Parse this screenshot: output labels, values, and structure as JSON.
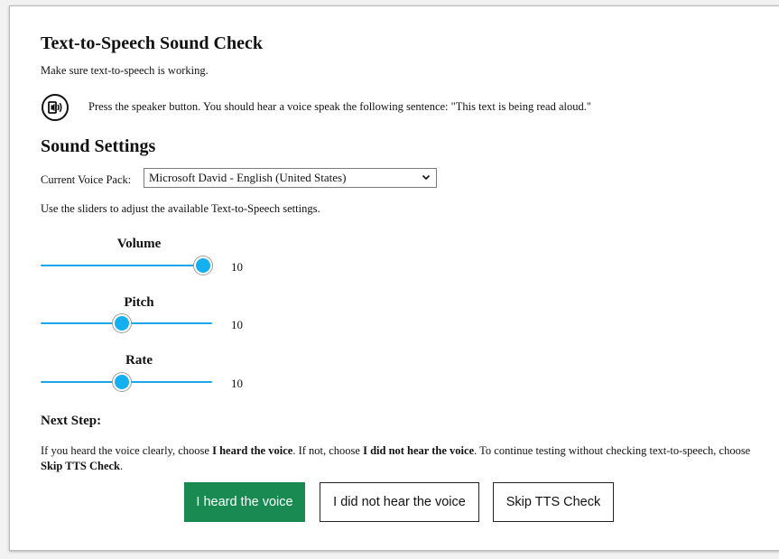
{
  "header": {
    "title": "Text-to-Speech Sound Check",
    "subtitle": "Make sure text-to-speech is working."
  },
  "speaker": {
    "icon": "speaker-icon",
    "instruction": "Press the speaker button. You should hear a voice speak the following sentence: \"This text is being read aloud.\""
  },
  "settings": {
    "title": "Sound Settings",
    "voice_pack_label": "Current Voice Pack:",
    "voice_pack_value": "Microsoft David - English (United States)",
    "sliders_hint": "Use the sliders to adjust the available Text-to-Speech settings.",
    "sliders": [
      {
        "label": "Volume",
        "value": "10",
        "level": 1.0
      },
      {
        "label": "Pitch",
        "value": "10",
        "level": 0.47
      },
      {
        "label": "Rate",
        "value": "10",
        "level": 0.47
      }
    ]
  },
  "next_step": {
    "title": "Next Step:",
    "text_1": "If you heard the voice clearly, choose ",
    "bold_1": "I heard the voice",
    "text_2": ". If not, choose ",
    "bold_2": "I did not hear the voice",
    "text_3": ". To continue testing without checking text-to-speech, choose ",
    "bold_3": "Skip TTS Check",
    "text_4": "."
  },
  "buttons": {
    "heard": "I heard the voice",
    "not_heard": "I did not hear the voice",
    "skip": "Skip TTS Check"
  },
  "colors": {
    "accent_green": "#188a52",
    "slider_blue": "#1aa6e8"
  }
}
